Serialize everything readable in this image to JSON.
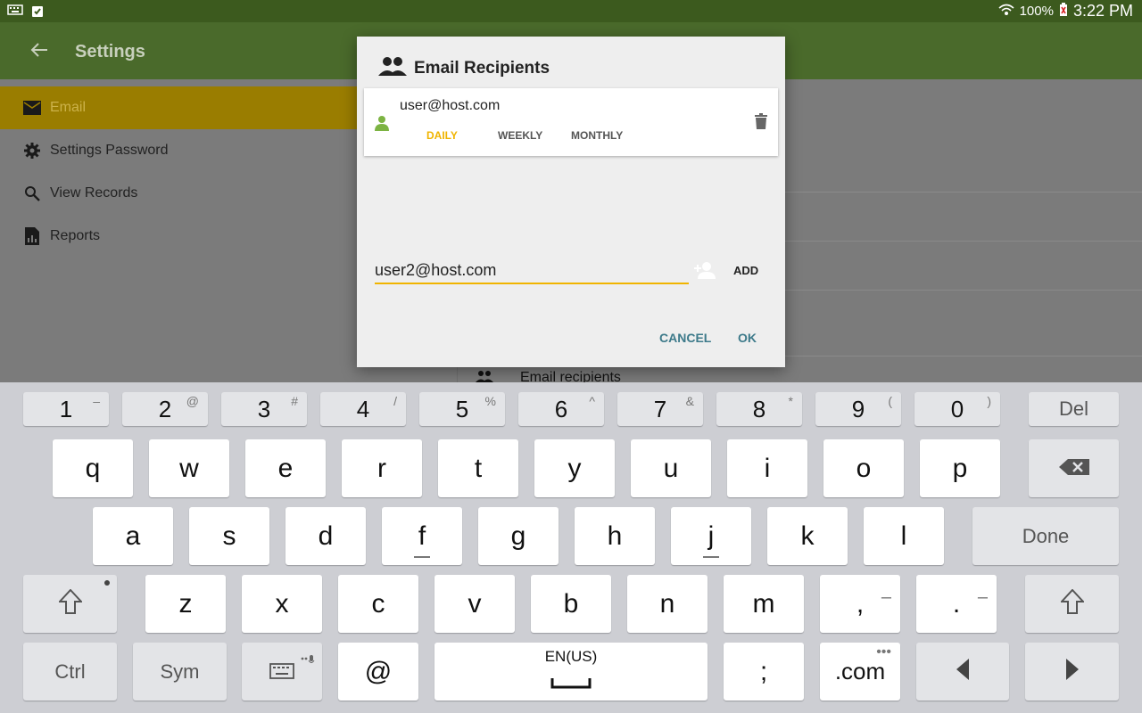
{
  "status_bar": {
    "battery": "100%",
    "time": "3:22 PM"
  },
  "app_bar": {
    "title": "Settings"
  },
  "nav": {
    "items": [
      {
        "label": "Email",
        "icon": "mail-icon",
        "active": true
      },
      {
        "label": "Settings Password",
        "icon": "gear-icon",
        "active": false
      },
      {
        "label": "View Records",
        "icon": "search-icon",
        "active": false
      },
      {
        "label": "Reports",
        "icon": "report-icon",
        "active": false
      }
    ]
  },
  "background_panel": {
    "email_recipients_label": "Email recipients"
  },
  "dialog": {
    "title": "Email Recipients",
    "recipient": {
      "email": "user@host.com",
      "frequency_daily": "DAILY",
      "frequency_weekly": "WEEKLY",
      "frequency_monthly": "MONTHLY",
      "selected_frequency": "DAILY"
    },
    "input_value": "user2@host.com",
    "add_label": "ADD",
    "cancel_label": "CANCEL",
    "ok_label": "OK"
  },
  "keyboard": {
    "number_row": [
      {
        "main": "1",
        "sup": "–"
      },
      {
        "main": "2",
        "sup": "@"
      },
      {
        "main": "3",
        "sup": "#"
      },
      {
        "main": "4",
        "sup": "/"
      },
      {
        "main": "5",
        "sup": "%"
      },
      {
        "main": "6",
        "sup": "^"
      },
      {
        "main": "7",
        "sup": "&"
      },
      {
        "main": "8",
        "sup": "*"
      },
      {
        "main": "9",
        "sup": "("
      },
      {
        "main": "0",
        "sup": ")"
      }
    ],
    "del": "Del",
    "row1": [
      "q",
      "w",
      "e",
      "r",
      "t",
      "y",
      "u",
      "i",
      "o",
      "p"
    ],
    "row2": [
      "a",
      "s",
      "d",
      "f",
      "g",
      "h",
      "j",
      "k",
      "l"
    ],
    "done": "Done",
    "row3": [
      "z",
      "x",
      "c",
      "v",
      "b",
      "n",
      "m",
      ",",
      "."
    ],
    "ctrl": "Ctrl",
    "sym": "Sym",
    "at": "@",
    "space": "EN(US)",
    "semicolon": ";",
    "dotcom": ".com"
  },
  "colors": {
    "status_bar": "#3c5a1e",
    "app_bar": "#4a6a2b",
    "accent": "#f0b400",
    "dialog_button": "#3d7a8a"
  }
}
